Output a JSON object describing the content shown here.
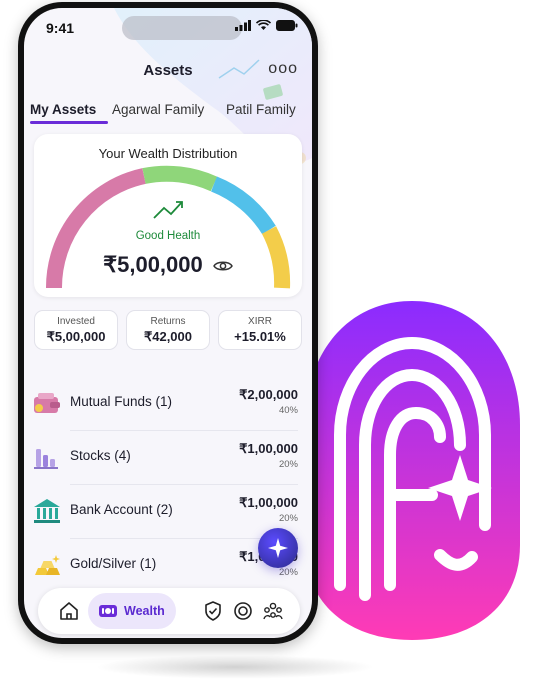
{
  "status": {
    "time": "9:41"
  },
  "header": {
    "title": "Assets",
    "more": "ooo"
  },
  "tabs": [
    {
      "label": "My Assets",
      "active": true
    },
    {
      "label": "Agarwal Family",
      "active": false
    },
    {
      "label": "Patil Family",
      "active": false
    }
  ],
  "wealth_card": {
    "title": "Your Wealth Distribution",
    "health_label": "Good Health",
    "total": "₹5,00,000",
    "gauge_colors": [
      "#d77aa8",
      "#8fd67a",
      "#52c0ea",
      "#f3cd4a"
    ]
  },
  "stats": [
    {
      "label": "Invested",
      "value": "₹5,00,000"
    },
    {
      "label": "Returns",
      "value": "₹42,000"
    },
    {
      "label": "XIRR",
      "value": "+15.01%"
    }
  ],
  "assets": [
    {
      "name": "Mutual Funds (1)",
      "amount": "₹2,00,000",
      "percent": "40%",
      "icon": "wallet-icon"
    },
    {
      "name": "Stocks (4)",
      "amount": "₹1,00,000",
      "percent": "20%",
      "icon": "bar-chart-icon"
    },
    {
      "name": "Bank Account (2)",
      "amount": "₹1,00,000",
      "percent": "20%",
      "icon": "bank-icon"
    },
    {
      "name": "Gold/Silver (1)",
      "amount": "₹1,00,000",
      "percent": "20%",
      "icon": "gold-bars-icon"
    }
  ],
  "bottom_nav": {
    "items": [
      "home-icon",
      "wealth-icon",
      "shield-check-icon",
      "target-icon",
      "family-icon"
    ],
    "active_label": "Wealth"
  },
  "colors": {
    "accent": "#6a2cd8",
    "brand_gradient_top": "#8b2cff",
    "brand_gradient_bottom": "#ff3bb5"
  }
}
